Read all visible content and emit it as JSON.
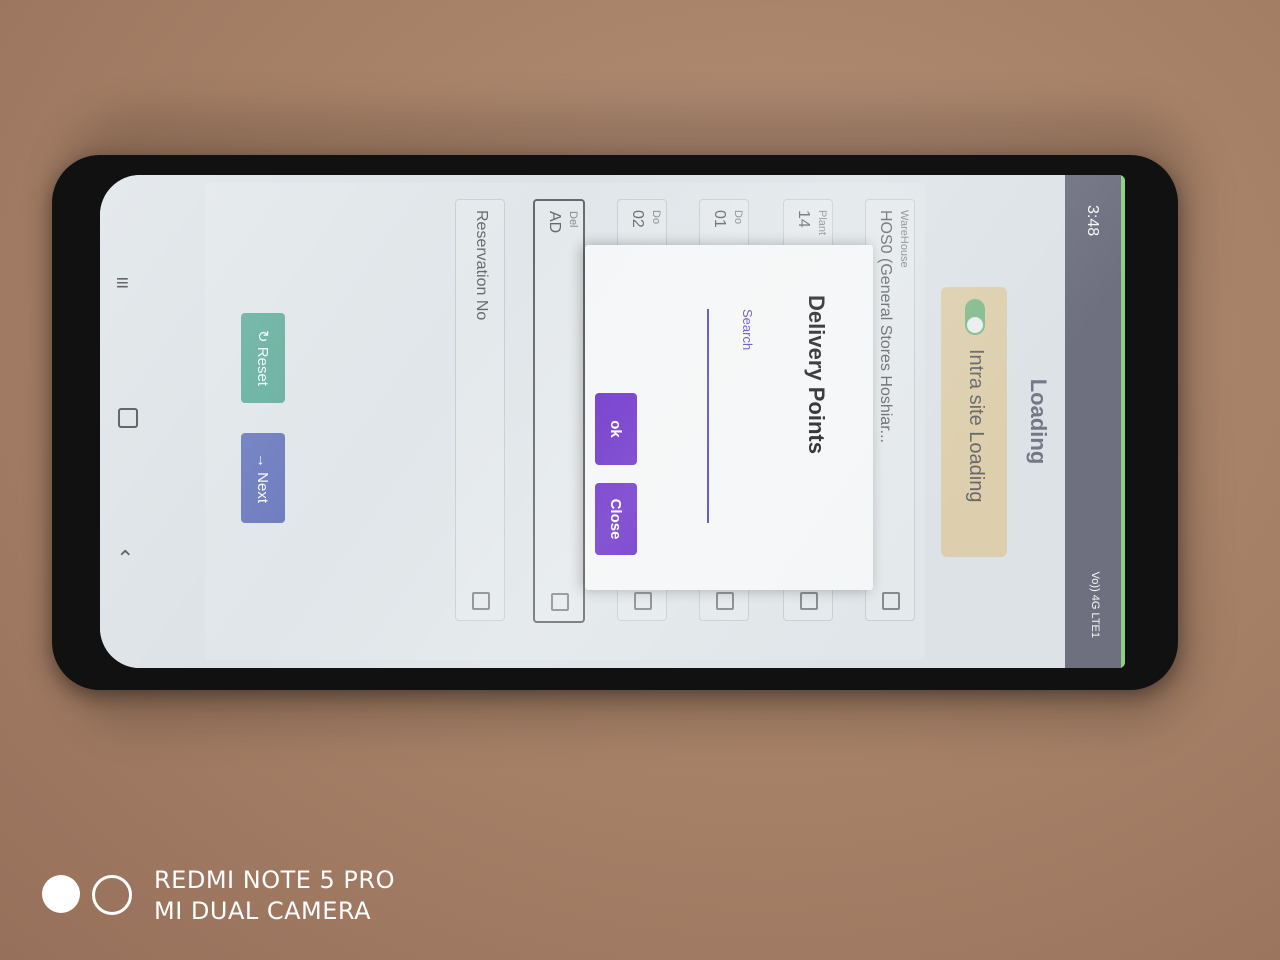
{
  "status_bar": {
    "time": "3:48",
    "network": "Vo)) 4G LTE1"
  },
  "app": {
    "title": "Loading",
    "toggle_label": "Intra site Loading",
    "fields": [
      {
        "label": "WareHouse",
        "value": "HOS0 (General Stores Hoshiar..."
      },
      {
        "label": "Plant",
        "value": "14"
      },
      {
        "label": "Do",
        "value": "01"
      },
      {
        "label": "Do",
        "value": "02"
      },
      {
        "label": "Del",
        "value": "AD"
      },
      {
        "label": "",
        "value": "Reservation No"
      }
    ],
    "reset_label": "Reset",
    "next_label": "Next"
  },
  "dialog": {
    "title": "Delivery Points",
    "search_label": "Search",
    "ok_label": "ok",
    "close_label": "Close"
  },
  "watermark": {
    "line1": "REDMI NOTE 5 PRO",
    "line2": "MI DUAL CAMERA"
  }
}
